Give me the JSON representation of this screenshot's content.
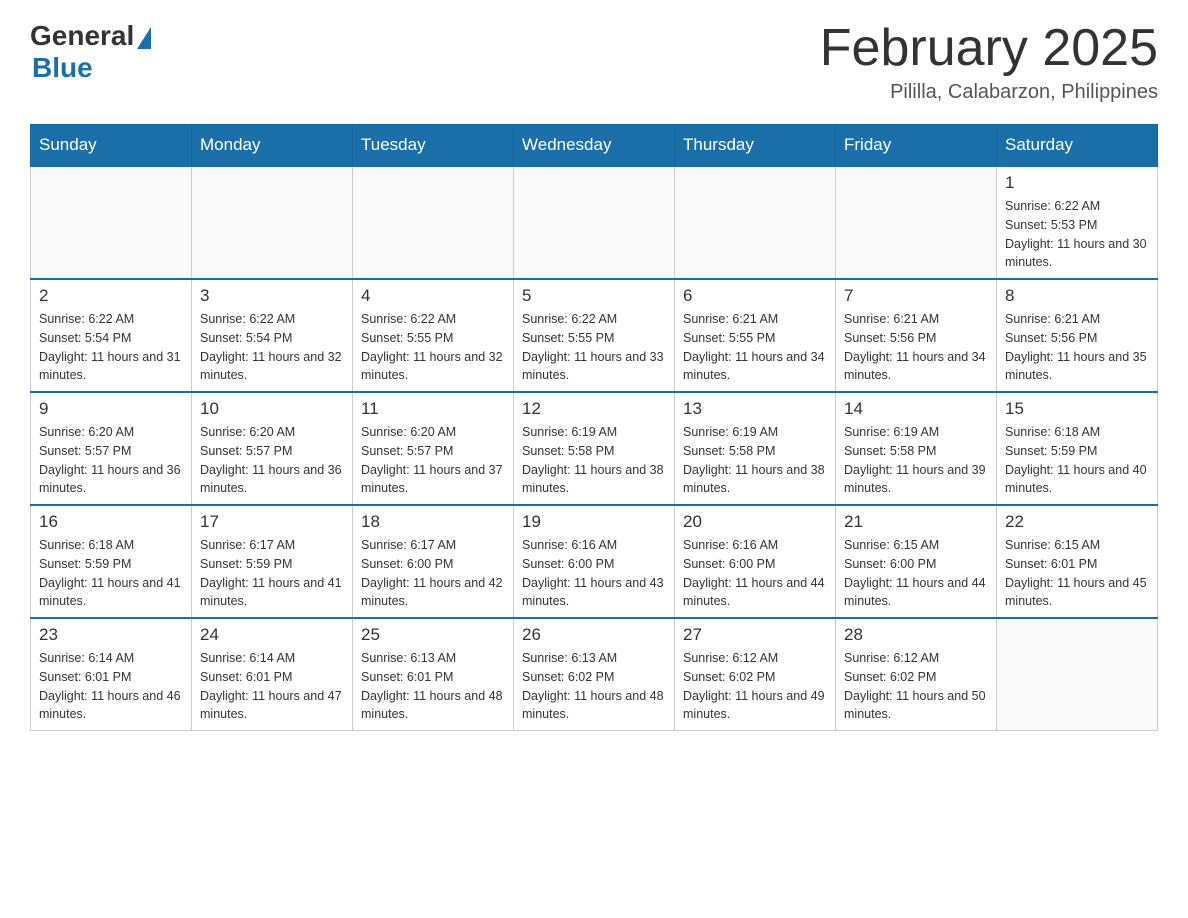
{
  "header": {
    "logo": {
      "general": "General",
      "blue": "Blue"
    },
    "title": "February 2025",
    "location": "Pililla, Calabarzon, Philippines"
  },
  "days_of_week": [
    "Sunday",
    "Monday",
    "Tuesday",
    "Wednesday",
    "Thursday",
    "Friday",
    "Saturday"
  ],
  "weeks": [
    [
      {
        "day": "",
        "info": ""
      },
      {
        "day": "",
        "info": ""
      },
      {
        "day": "",
        "info": ""
      },
      {
        "day": "",
        "info": ""
      },
      {
        "day": "",
        "info": ""
      },
      {
        "day": "",
        "info": ""
      },
      {
        "day": "1",
        "info": "Sunrise: 6:22 AM\nSunset: 5:53 PM\nDaylight: 11 hours and 30 minutes."
      }
    ],
    [
      {
        "day": "2",
        "info": "Sunrise: 6:22 AM\nSunset: 5:54 PM\nDaylight: 11 hours and 31 minutes."
      },
      {
        "day": "3",
        "info": "Sunrise: 6:22 AM\nSunset: 5:54 PM\nDaylight: 11 hours and 32 minutes."
      },
      {
        "day": "4",
        "info": "Sunrise: 6:22 AM\nSunset: 5:55 PM\nDaylight: 11 hours and 32 minutes."
      },
      {
        "day": "5",
        "info": "Sunrise: 6:22 AM\nSunset: 5:55 PM\nDaylight: 11 hours and 33 minutes."
      },
      {
        "day": "6",
        "info": "Sunrise: 6:21 AM\nSunset: 5:55 PM\nDaylight: 11 hours and 34 minutes."
      },
      {
        "day": "7",
        "info": "Sunrise: 6:21 AM\nSunset: 5:56 PM\nDaylight: 11 hours and 34 minutes."
      },
      {
        "day": "8",
        "info": "Sunrise: 6:21 AM\nSunset: 5:56 PM\nDaylight: 11 hours and 35 minutes."
      }
    ],
    [
      {
        "day": "9",
        "info": "Sunrise: 6:20 AM\nSunset: 5:57 PM\nDaylight: 11 hours and 36 minutes."
      },
      {
        "day": "10",
        "info": "Sunrise: 6:20 AM\nSunset: 5:57 PM\nDaylight: 11 hours and 36 minutes."
      },
      {
        "day": "11",
        "info": "Sunrise: 6:20 AM\nSunset: 5:57 PM\nDaylight: 11 hours and 37 minutes."
      },
      {
        "day": "12",
        "info": "Sunrise: 6:19 AM\nSunset: 5:58 PM\nDaylight: 11 hours and 38 minutes."
      },
      {
        "day": "13",
        "info": "Sunrise: 6:19 AM\nSunset: 5:58 PM\nDaylight: 11 hours and 38 minutes."
      },
      {
        "day": "14",
        "info": "Sunrise: 6:19 AM\nSunset: 5:58 PM\nDaylight: 11 hours and 39 minutes."
      },
      {
        "day": "15",
        "info": "Sunrise: 6:18 AM\nSunset: 5:59 PM\nDaylight: 11 hours and 40 minutes."
      }
    ],
    [
      {
        "day": "16",
        "info": "Sunrise: 6:18 AM\nSunset: 5:59 PM\nDaylight: 11 hours and 41 minutes."
      },
      {
        "day": "17",
        "info": "Sunrise: 6:17 AM\nSunset: 5:59 PM\nDaylight: 11 hours and 41 minutes."
      },
      {
        "day": "18",
        "info": "Sunrise: 6:17 AM\nSunset: 6:00 PM\nDaylight: 11 hours and 42 minutes."
      },
      {
        "day": "19",
        "info": "Sunrise: 6:16 AM\nSunset: 6:00 PM\nDaylight: 11 hours and 43 minutes."
      },
      {
        "day": "20",
        "info": "Sunrise: 6:16 AM\nSunset: 6:00 PM\nDaylight: 11 hours and 44 minutes."
      },
      {
        "day": "21",
        "info": "Sunrise: 6:15 AM\nSunset: 6:00 PM\nDaylight: 11 hours and 44 minutes."
      },
      {
        "day": "22",
        "info": "Sunrise: 6:15 AM\nSunset: 6:01 PM\nDaylight: 11 hours and 45 minutes."
      }
    ],
    [
      {
        "day": "23",
        "info": "Sunrise: 6:14 AM\nSunset: 6:01 PM\nDaylight: 11 hours and 46 minutes."
      },
      {
        "day": "24",
        "info": "Sunrise: 6:14 AM\nSunset: 6:01 PM\nDaylight: 11 hours and 47 minutes."
      },
      {
        "day": "25",
        "info": "Sunrise: 6:13 AM\nSunset: 6:01 PM\nDaylight: 11 hours and 48 minutes."
      },
      {
        "day": "26",
        "info": "Sunrise: 6:13 AM\nSunset: 6:02 PM\nDaylight: 11 hours and 48 minutes."
      },
      {
        "day": "27",
        "info": "Sunrise: 6:12 AM\nSunset: 6:02 PM\nDaylight: 11 hours and 49 minutes."
      },
      {
        "day": "28",
        "info": "Sunrise: 6:12 AM\nSunset: 6:02 PM\nDaylight: 11 hours and 50 minutes."
      },
      {
        "day": "",
        "info": ""
      }
    ]
  ]
}
